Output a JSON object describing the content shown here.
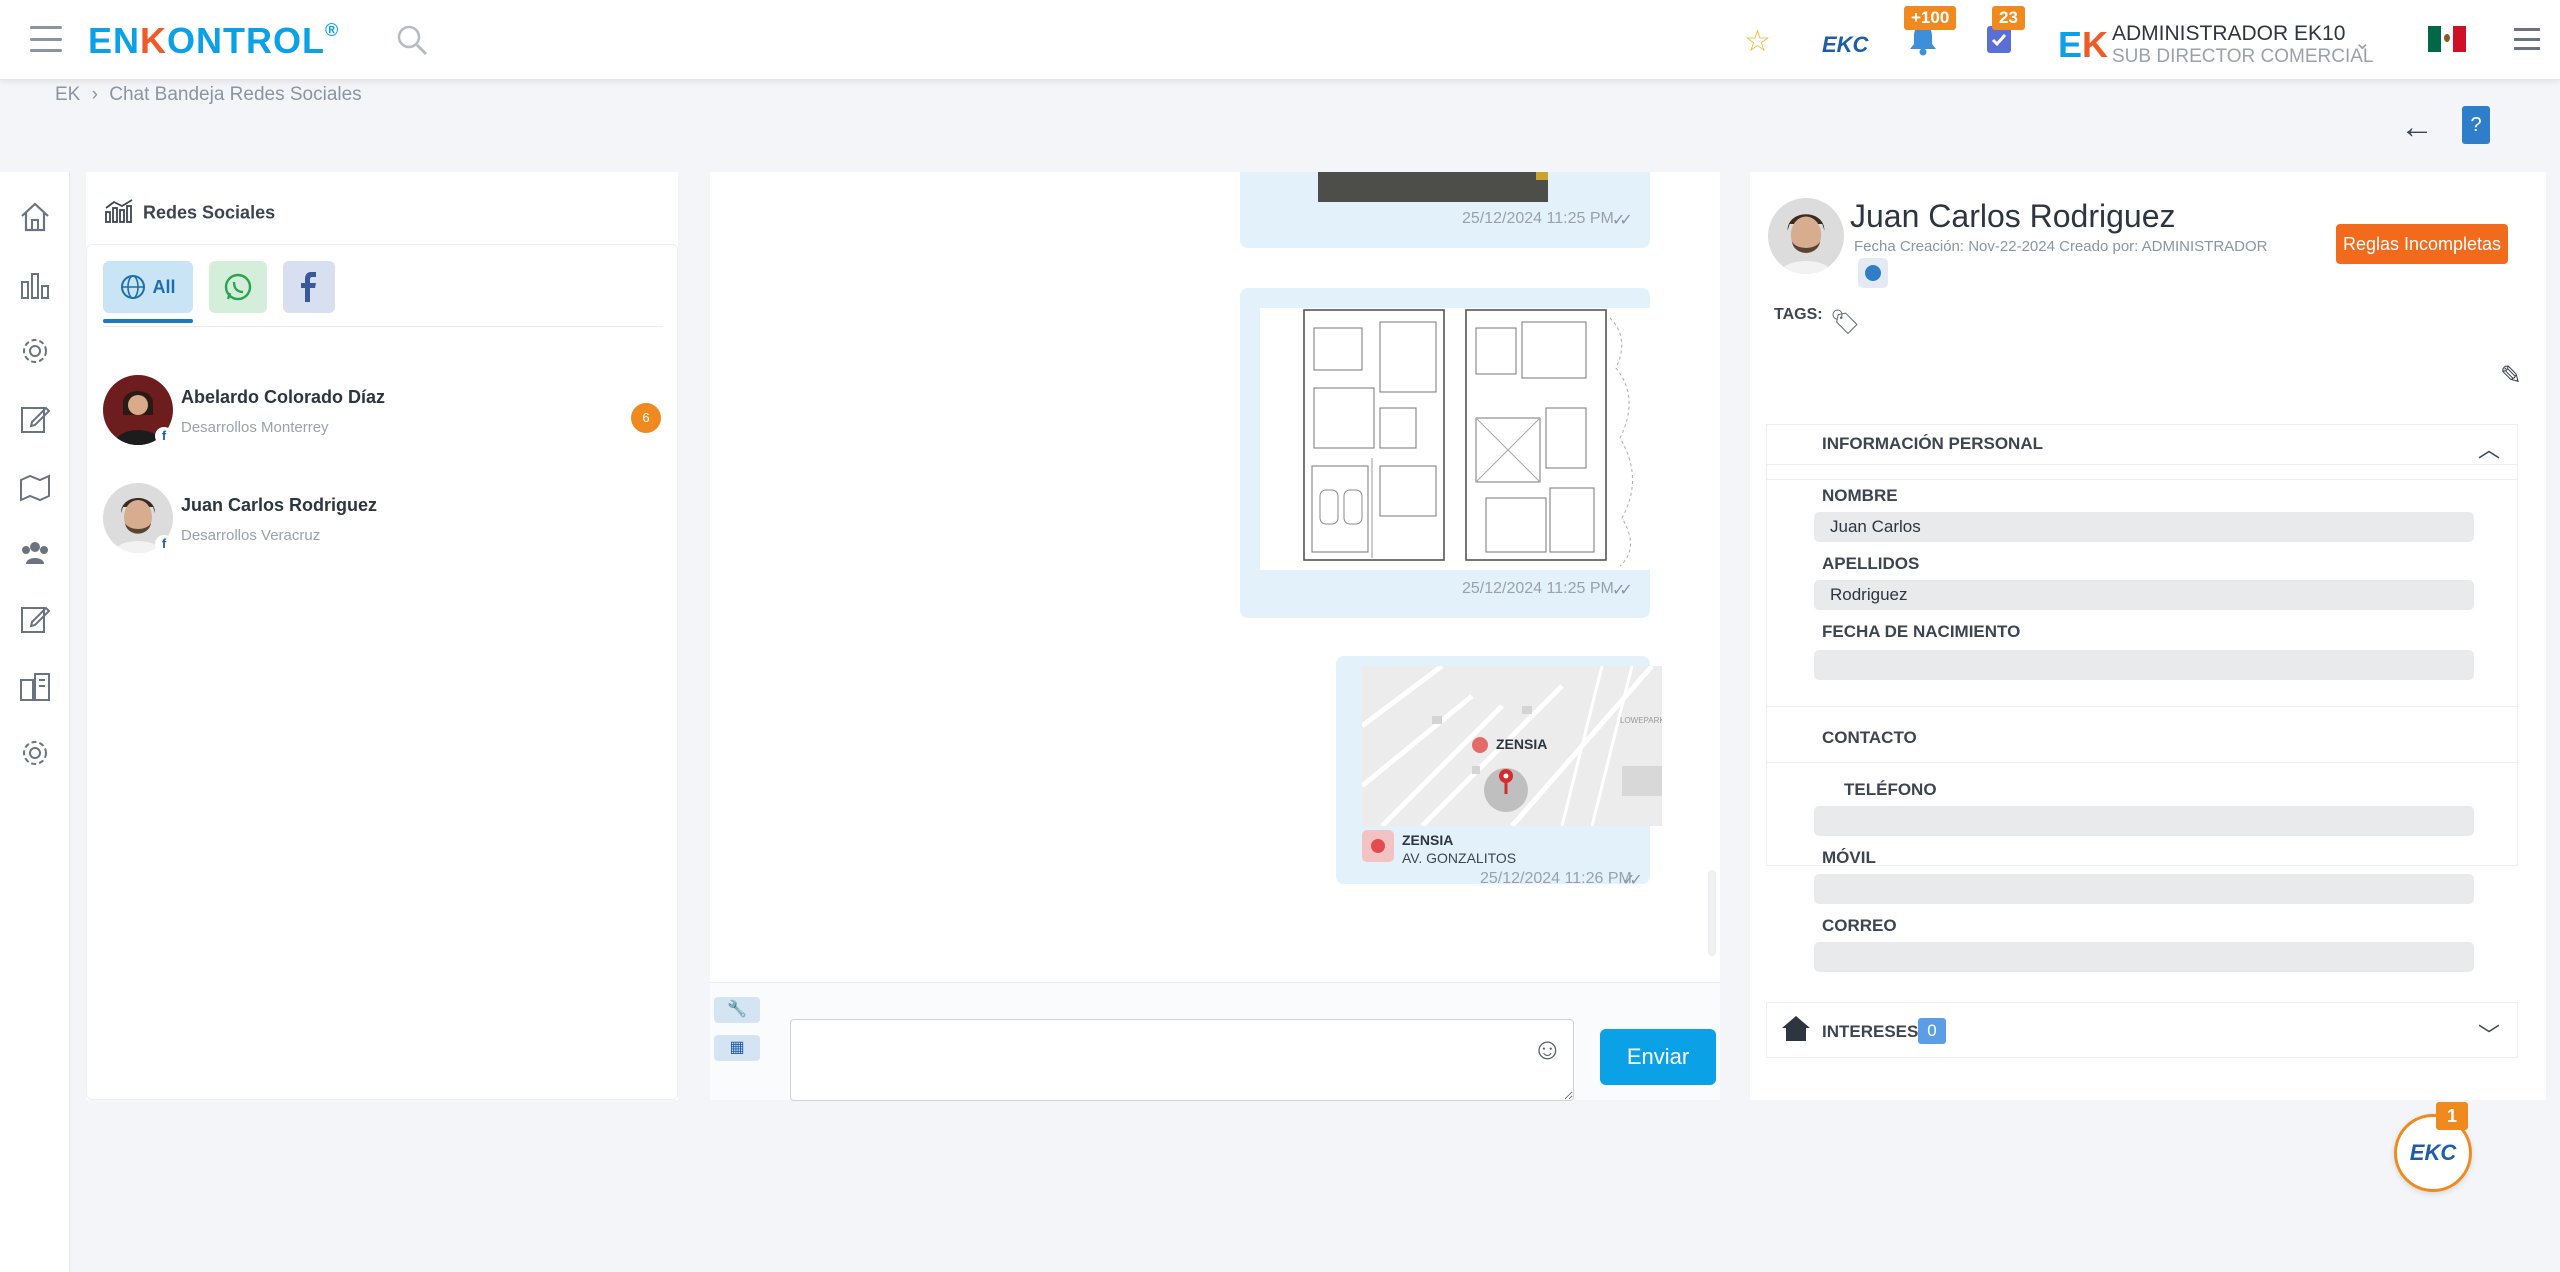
{
  "header": {
    "logo_main": "EN",
    "logo_k": "K",
    "logo_rest": "ONTROL",
    "logo_reg": "®",
    "search_icon": "search-icon",
    "favorite_icon": "star-icon",
    "app_badge_text": "EKC",
    "notifications_count": "+100",
    "tasks_count": "23",
    "user_name": "ADMINISTRADOR EK10",
    "user_role": "SUB DIRECTOR COMERCIAL",
    "user_logo_e": "E",
    "user_logo_k": "K",
    "chevron": "⌄"
  },
  "breadcrumb": {
    "root": "EK",
    "sep": "›",
    "current": "Chat Bandeja Redes Sociales"
  },
  "left_panel": {
    "title": "Redes Sociales",
    "filter_all_label": "All",
    "contacts": [
      {
        "name": "Abelardo Colorado Díaz",
        "subtitle": "Desarrollos Monterrey",
        "unread": "6"
      },
      {
        "name": "Juan Carlos Rodriguez",
        "subtitle": "Desarrollos Veracruz"
      }
    ]
  },
  "chat": {
    "messages": [
      {
        "type": "image",
        "time": "25/12/2024 11:25 PM"
      },
      {
        "type": "image-floorplan",
        "time": "25/12/2024 11:25 PM"
      },
      {
        "type": "location",
        "place_label": "ZENSIA",
        "place_title": "ZENSIA",
        "place_address": "AV. GONZALITOS",
        "map_label": "LOWEPARK",
        "time": "25/12/2024 11:26 PM"
      }
    ],
    "ticks": "✓✓",
    "composer": {
      "placeholder": "",
      "send_label": "Enviar"
    }
  },
  "profile": {
    "name": "Juan Carlos Rodriguez",
    "meta": "Fecha Creación: Nov-22-2024 Creado por: ADMINISTRADOR",
    "rules_button": "Reglas Incompletas",
    "tags_label": "TAGS:",
    "personal_section": "INFORMACIÓN PERSONAL",
    "fields_personal": [
      {
        "label": "NOMBRE",
        "value": "Juan Carlos"
      },
      {
        "label": "APELLIDOS",
        "value": "Rodriguez"
      },
      {
        "label": "FECHA DE NACIMIENTO",
        "value": ""
      }
    ],
    "contact_section": "CONTACTO",
    "fields_contact": [
      {
        "label": "TELÉFONO",
        "value": ""
      },
      {
        "label": "MÓVIL",
        "value": ""
      },
      {
        "label": "CORREO",
        "value": ""
      }
    ],
    "interests_label": "INTERESES",
    "interests_count": "0"
  },
  "fab": {
    "label": "EKC",
    "badge": "1"
  },
  "colors": {
    "brand_blue": "#0aa1e6",
    "brand_orange": "#f05a28",
    "badge_orange": "#f08a1e",
    "bubble": "#e3f1fb"
  }
}
